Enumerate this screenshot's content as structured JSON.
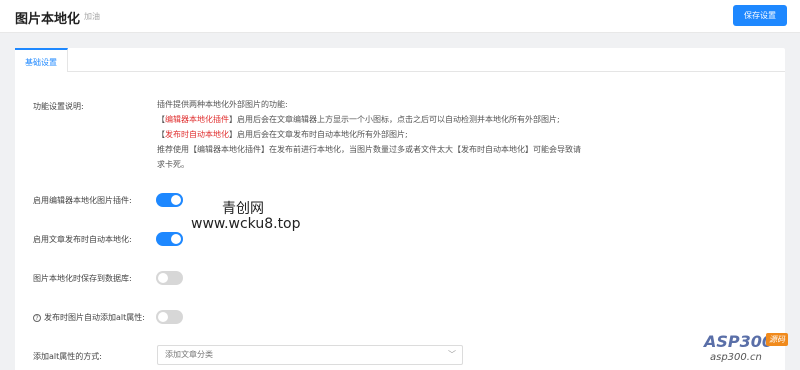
{
  "header": {
    "title": "图片本地化",
    "subtitle": "加油",
    "save_label": "保存设置"
  },
  "tabs": [
    {
      "label": "基础设置",
      "active": true
    }
  ],
  "description": {
    "label": "功能设置说明:",
    "line1": "插件提供两种本地化外部图片的功能:",
    "line2_prefix": "【",
    "line2_highlight": "编辑器本地化插件",
    "line2_rest": "】启用后会在文章编辑器上方显示一个小图标，点击之后可以自动检测并本地化所有外部图片;",
    "line3_prefix": "【",
    "line3_highlight": "发布时自动本地化",
    "line3_rest": "】启用后会在文章发布时自动本地化所有外部图片;",
    "line4": "推荐使用【编辑器本地化插件】在发布前进行本地化，当图片数量过多或者文件太大【发布时自动本地化】可能会导致请",
    "line5": "求卡死。"
  },
  "settings": [
    {
      "label": "启用编辑器本地化图片插件:",
      "enabled": true
    },
    {
      "label": "启用文章发布时自动本地化:",
      "enabled": true
    },
    {
      "label": "图片本地化时保存到数据库:",
      "enabled": false
    },
    {
      "label": "发布时图片自动添加alt属性:",
      "enabled": false,
      "has_help_icon": true
    }
  ],
  "alt_method": {
    "label": "添加alt属性的方式:",
    "selected": "添加文章分类"
  },
  "watermark": {
    "line1": "青创网",
    "line2": "www.wcku8.top"
  },
  "logo": {
    "main": "ASP300",
    "badge": "源码",
    "url": "asp300.cn"
  },
  "colors": {
    "accent": "#1e88ff",
    "highlight_red": "#e02f2f",
    "toggle_off": "#d7d7d7"
  }
}
